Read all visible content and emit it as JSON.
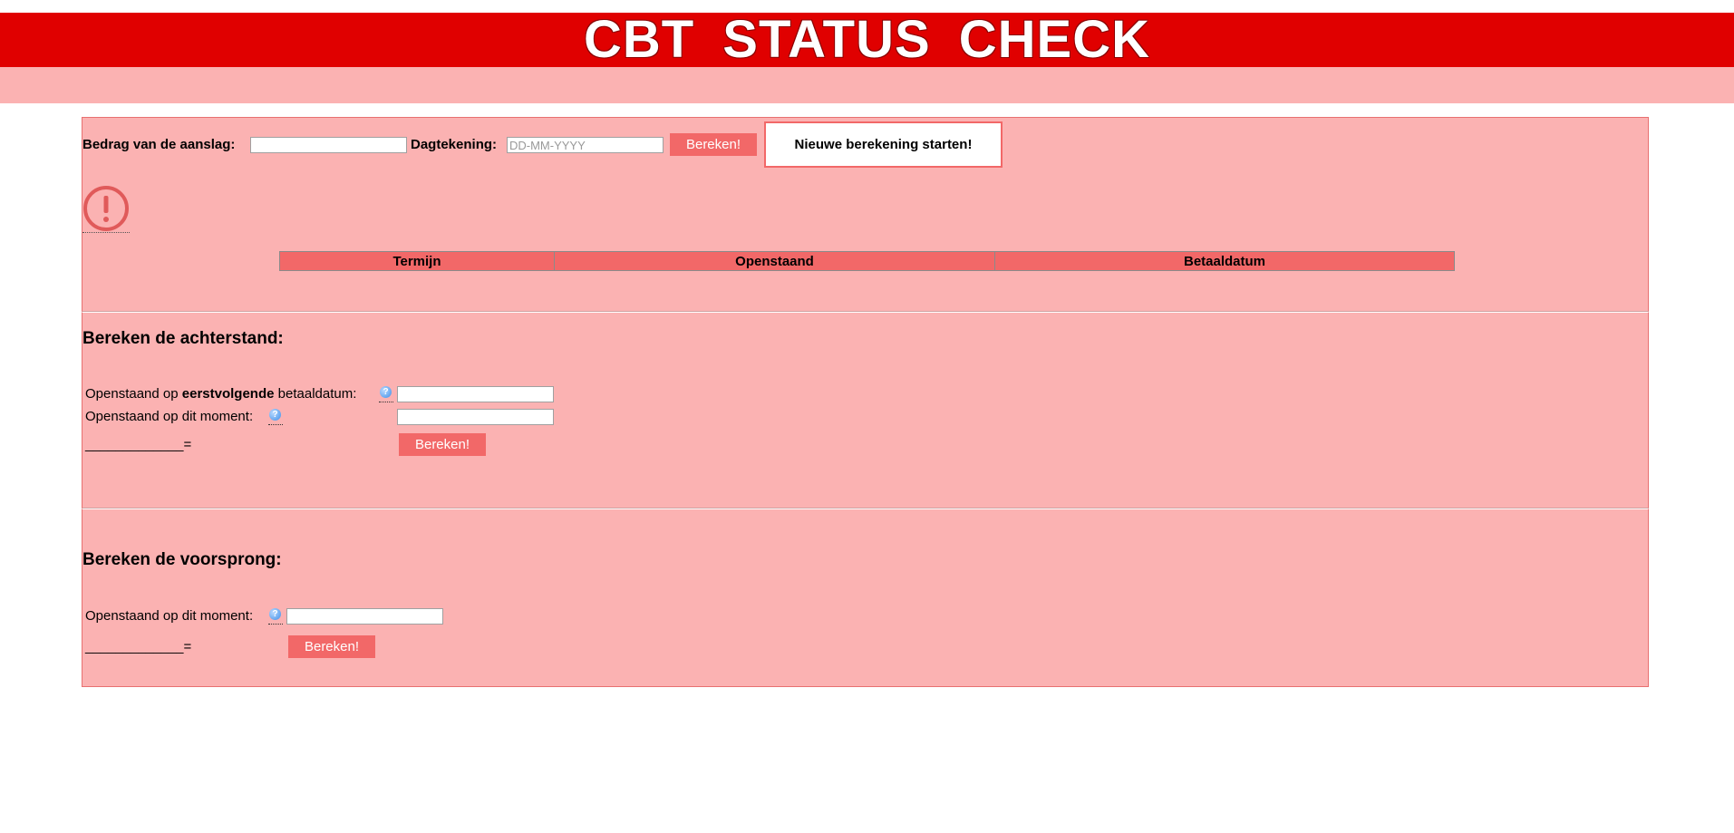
{
  "header": {
    "title": "CBT  STATUS  CHECK"
  },
  "main": {
    "amount_label": "Bedrag van de aanslag:",
    "amount_value": "",
    "date_label": "Dagtekening:",
    "date_placeholder": "DD-MM-YYYY",
    "calc_button": "Bereken!",
    "reset_button": "Nieuwe berekening starten!",
    "alert_icon": "exclamation-circle-icon",
    "table": {
      "columns": [
        "Termijn",
        "Openstaand",
        "Betaaldatum"
      ]
    }
  },
  "arrears": {
    "heading": "Bereken de achterstand:",
    "row1_label_pre": "Openstaand op ",
    "row1_label_bold": "eerstvolgende",
    "row1_label_post": " betaaldatum:",
    "row2_label": "Openstaand op dit moment:",
    "row1_value": "",
    "row2_value": "",
    "result_line": "_____________=",
    "calc_button": "Bereken!",
    "help_icon": "help-question-icon"
  },
  "lead": {
    "heading": "Bereken de voorsprong:",
    "row_label": "Openstaand op dit moment:",
    "row_value": "",
    "result_line": "_____________=",
    "calc_button": "Bereken!",
    "help_icon": "help-question-icon"
  },
  "colors": {
    "header_red": "#e00000",
    "panel_pink": "#fbb2b2",
    "button_red": "#f26868"
  }
}
